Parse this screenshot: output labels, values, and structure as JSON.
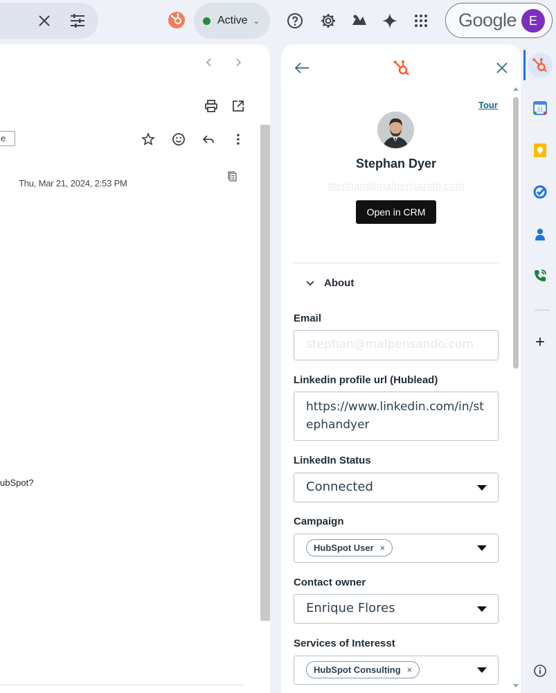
{
  "topbar": {
    "status_label": "Active",
    "status_caret": "⌄",
    "google_label": "Google",
    "account_initial": "E",
    "icons": [
      "close-icon",
      "tune-icon",
      "hubspot-icon",
      "help-icon",
      "settings-icon",
      "addon-icon",
      "gemini-icon",
      "apps-icon"
    ]
  },
  "mail": {
    "label_fragment": "e",
    "date": "Thu, Mar 21, 2024, 2:53 PM",
    "body_fragment": "ubSpot?"
  },
  "hubspot": {
    "tour_link": "Tour",
    "contact_name": "Stephan Dyer",
    "contact_email": "stephan@malpensando.com",
    "open_crm_label": "Open in CRM",
    "about_label": "About",
    "fields": {
      "email": {
        "label": "Email",
        "placeholder": "stephan@malpensando.com"
      },
      "linkedin_url": {
        "label": "Linkedin profile url (Hublead)",
        "value_line1": "https://www.linkedin.com/in/st",
        "value_line2": "ephandyer"
      },
      "linkedin_status": {
        "label": "LinkedIn Status",
        "value": "Connected"
      },
      "campaign": {
        "label": "Campaign",
        "tag": "HubSpot User",
        "tag_remove": "×"
      },
      "contact_owner": {
        "label": "Contact owner",
        "value": "Enrique Flores"
      },
      "services": {
        "label": "Services of Interesst",
        "tag": "HubSpot Consulting",
        "tag_remove": "×"
      }
    }
  },
  "rail": {
    "icons": [
      "hubspot-icon",
      "calendar-icon",
      "keep-icon",
      "tasks-icon",
      "contacts-icon",
      "phone-icon",
      "add-icon",
      "info-icon"
    ],
    "calendar_day": "31",
    "add_symbol": "+"
  },
  "colors": {
    "hubspot_orange": "#ff5c35",
    "active_green": "#1e8e3e",
    "avatar_purple": "#7b2fbf",
    "link_teal": "#0b6f8a"
  }
}
